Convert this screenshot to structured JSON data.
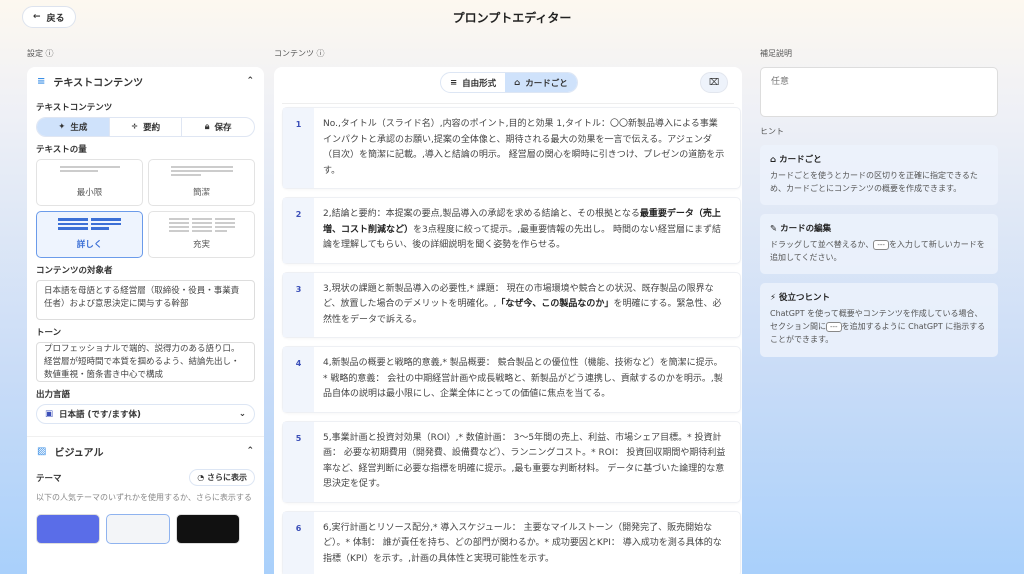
{
  "header": {
    "back_label": "戻る",
    "title": "プロンプトエディター"
  },
  "left": {
    "section_label": "設定",
    "text_section": {
      "title": "テキストコンテンツ",
      "content_label": "テキストコンテンツ",
      "modes": [
        {
          "label": "生成",
          "icon": "sparkle-icon",
          "selected": true
        },
        {
          "label": "要約",
          "icon": "divide-icon",
          "selected": false
        },
        {
          "label": "保存",
          "icon": "lock-icon",
          "selected": false
        }
      ],
      "amount_label": "テキストの量",
      "amounts": [
        {
          "label": "最小限",
          "selected": false
        },
        {
          "label": "簡潔",
          "selected": false
        },
        {
          "label": "詳しく",
          "selected": true
        },
        {
          "label": "充実",
          "selected": false
        }
      ],
      "audience_label": "コンテンツの対象者",
      "audience_value": "日本語を母語とする経営層（取締役・役員・事業責任者）および意思決定に関与する幹部",
      "tone_label": "トーン",
      "tone_value": "プロフェッショナルで端的、説得力のある語り口。経営層が短時間で本質を掴めるよう、結論先出し・数値重視・箇条書き中心で構成",
      "language_label": "出力言語",
      "language_value": "日本語 (です/ます体)"
    },
    "visual_section": {
      "title": "ビジュアル",
      "theme_label": "テーマ",
      "more_label": "さらに表示",
      "theme_desc": "以下の人気テーマのいずれかを使用するか、さらに表示する"
    }
  },
  "middle": {
    "section_label": "コンテンツ",
    "toggle": [
      {
        "label": "自由形式",
        "selected": false
      },
      {
        "label": "カードごと",
        "selected": true
      }
    ],
    "cards": [
      {
        "num": "1",
        "parts": [
          {
            "t": "No.,タイトル（スライド名）,内容のポイント,目的と効果 1,タイトル：〇〇新製品導入による事業インパクトと承認のお願い,提案の全体像と、期待される最大の効果を一言で伝える。アジェンダ（目次）を簡潔に記載。,導入と結論の明示。 経営層の関心を瞬時に引きつけ、プレゼンの道筋を示す。"
          }
        ]
      },
      {
        "num": "2",
        "parts": [
          {
            "t": "2,結論と要約：本提案の要点,製品導入の承認を求める結論と、その根拠となる"
          },
          {
            "t": "最重要データ（売上増、コスト削減など）",
            "b": true
          },
          {
            "t": "を3点程度に絞って提示。,最重要情報の先出し。 時間のない経営層にまず結論を理解してもらい、後の詳細説明を聞く姿勢を作らせる。"
          }
        ]
      },
      {
        "num": "3",
        "parts": [
          {
            "t": "3,現状の課題と新製品導入の必要性,* 課題： 現在の市場環境や競合との状況、既存製品の限界など、放置した場合のデメリットを明確化。,"
          },
          {
            "t": "「なぜ今、この製品なのか」",
            "b": true
          },
          {
            "t": "を明確にする。緊急性、必然性をデータで訴える。"
          }
        ]
      },
      {
        "num": "4",
        "parts": [
          {
            "t": "4,新製品の概要と戦略的意義,* 製品概要： 競合製品との優位性（機能、技術など）を簡潔に提示。* 戦略的意義： 会社の中期経営計画や成長戦略と、新製品がどう連携し、貢献するのかを明示。,製品自体の説明は最小限にし、企業全体にとっての価値に焦点を当てる。"
          }
        ]
      },
      {
        "num": "5",
        "parts": [
          {
            "t": "5,事業計画と投資対効果（ROI）,* 数値計画： 3〜5年間の売上、利益、市場シェア目標。* 投資計画： 必要な初期費用（開発費、設備費など）、ランニングコスト。* ROI： 投資回収期間や期待利益率など、経営判断に必要な指標を明確に提示。,最も重要な判断材料。 データに基づいた論理的な意思決定を促す。"
          }
        ]
      },
      {
        "num": "6",
        "parts": [
          {
            "t": "6,実行計画とリソース配分,* 導入スケジュール： 主要なマイルストーン（開発完了、販売開始など）。* 体制： 誰が責任を持ち、どの部門が関わるか。* 成功要因とKPI： 導入成功を測る具体的な指標（KPI）を示す。,計画の具体性と実現可能性を示す。"
          }
        ]
      }
    ]
  },
  "right": {
    "note_label": "補足説明",
    "note_placeholder": "任意",
    "hints_label": "ヒント",
    "hints": [
      {
        "title": "カードごと",
        "body": "カードごとを使うとカードの区切りを正確に指定できるため、カードごとにコンテンツの概要を作成できます。"
      },
      {
        "title": "カードの編集",
        "body_pre": "ドラッグして並べ替えるか、",
        "kbd": "---",
        "body_post": "を入力して新しいカードを追加してください。"
      },
      {
        "title": "役立つヒント",
        "body_pre": "ChatGPT を使って概要やコンテンツを作成している場合、セクション間に",
        "kbd": "---",
        "body_post": "を追加するように ChatGPT に指示することができます。"
      }
    ]
  },
  "colors": {
    "accent": "#3b6fd6",
    "selected_bg": "#cfe2fb"
  }
}
